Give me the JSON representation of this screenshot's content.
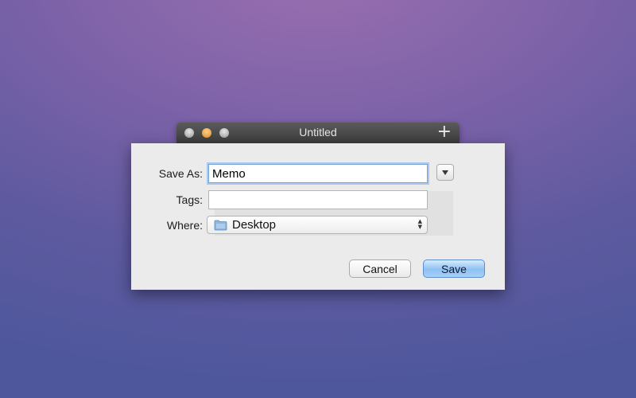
{
  "window": {
    "title": "Untitled",
    "plus_label": "+"
  },
  "dialog": {
    "save_as_label": "Save As:",
    "save_as_value": "Memo",
    "tags_label": "Tags:",
    "tags_value": "",
    "where_label": "Where:",
    "where_value": "Desktop",
    "where_icon": "folder-icon",
    "expand_icon": "triangle-down-icon"
  },
  "buttons": {
    "cancel": "Cancel",
    "save": "Save"
  },
  "colors": {
    "accent": "#8ec0f2",
    "focus_ring": "#a9c8ee"
  }
}
